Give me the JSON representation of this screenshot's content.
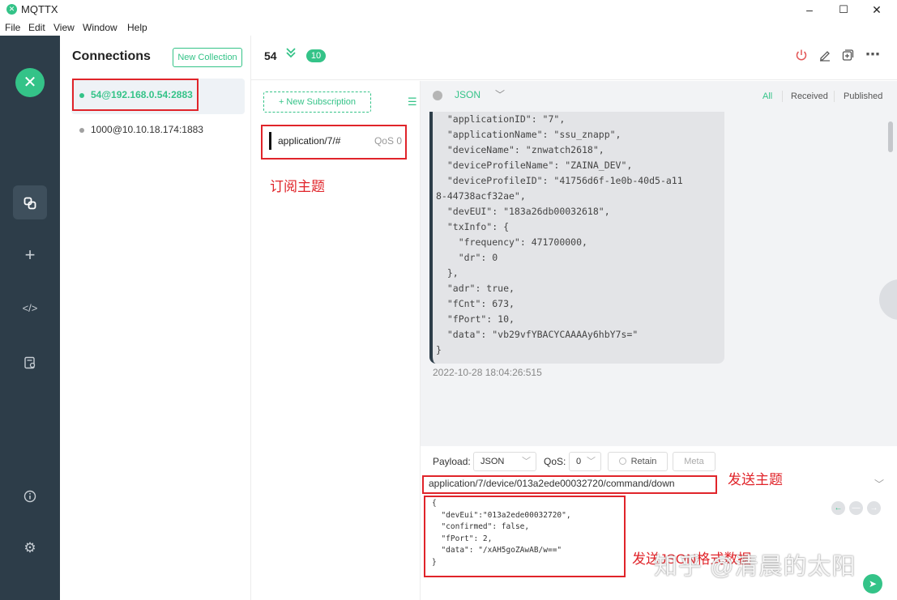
{
  "window": {
    "title": "MQTTX",
    "controls": {
      "minimize": "–",
      "maximize": "☐",
      "close": "✕"
    }
  },
  "menu": [
    "File",
    "Edit",
    "View",
    "Window",
    "Help"
  ],
  "sidebar": {
    "logo": "✕",
    "icons": [
      "connections-icon",
      "add-icon",
      "script-icon",
      "log-icon",
      "about-icon",
      "settings-icon"
    ]
  },
  "connections": {
    "title": "Connections",
    "new_collection": "New Collection",
    "items": [
      {
        "name": "54@192.168.0.54:2883",
        "status_color": "#34c388",
        "active": true
      },
      {
        "name": "1000@10.10.18.174:1883",
        "status_color": "#a0a0a0",
        "active": false
      }
    ]
  },
  "header": {
    "name": "54",
    "badge": "10"
  },
  "subscriptions": {
    "new_subscription": "+ New Subscription",
    "items": [
      {
        "topic": "application/7/#",
        "qos": "QoS 0",
        "color": "#111111"
      }
    ]
  },
  "messages": {
    "format": "JSON",
    "filters": [
      "All",
      "Received",
      "Published"
    ],
    "active_filter": "All",
    "items": [
      {
        "payload": "  \"applicationID\": \"7\",\n  \"applicationName\": \"ssu_znapp\",\n  \"deviceName\": \"znwatch2618\",\n  \"deviceProfileName\": \"ZAINA_DEV\",\n  \"deviceProfileID\": \"41756d6f-1e0b-40d5-a11\n8-44738acf32ae\",\n  \"devEUI\": \"183a26db00032618\",\n  \"txInfo\": {\n    \"frequency\": 471700000,\n    \"dr\": 0\n  },\n  \"adr\": true,\n  \"fCnt\": 673,\n  \"fPort\": 10,\n  \"data\": \"vb29vfYBACYCAAAAy6hbY7s=\"\n}",
        "time": "2022-10-28 18:04:26:515"
      }
    ]
  },
  "publish": {
    "payload_label": "Payload:",
    "payload_format": "JSON",
    "qos_label": "QoS:",
    "qos_value": "0",
    "retain_label": "Retain",
    "meta_label": "Meta",
    "topic": "application/7/device/013a2ede00032720/command/down",
    "payload_lines": [
      "{",
      "  \"devEui\":\"013a2ede00032720\",",
      "  \"confirmed\": false,",
      "  \"fPort\": 2,",
      "  \"data\": \"/xAH5goZAwAB/w==\"",
      "}"
    ]
  },
  "annotations": {
    "subscribe_topic": "订阅主题",
    "send_topic": "发送主题",
    "send_json": "发送JSON格式数据"
  },
  "watermark": "知乎 @清晨的太阳",
  "colors": {
    "accent": "#34c388",
    "nav_bg": "#2d3d49",
    "annotation_red": "#e0242a"
  }
}
